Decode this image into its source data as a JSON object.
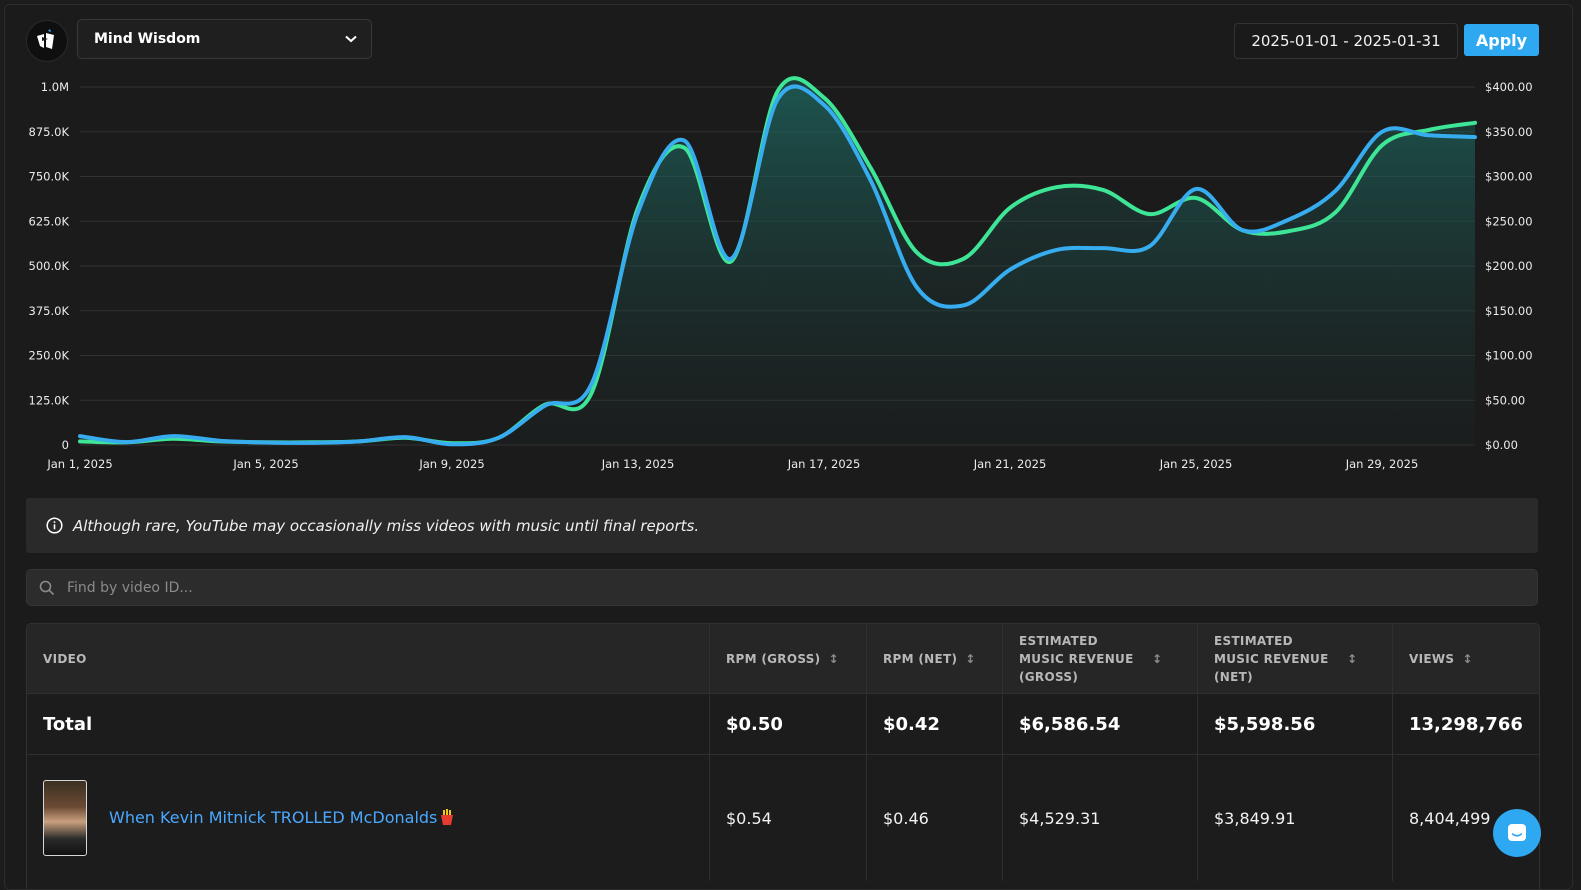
{
  "header": {
    "channel_name": "Mind Wisdom",
    "date_range": "2025-01-01 - 2025-01-31",
    "apply_label": "Apply"
  },
  "chart_data": {
    "type": "area",
    "x": [
      "Jan 1, 2025",
      "Jan 2, 2025",
      "Jan 3, 2025",
      "Jan 4, 2025",
      "Jan 5, 2025",
      "Jan 6, 2025",
      "Jan 7, 2025",
      "Jan 8, 2025",
      "Jan 9, 2025",
      "Jan 10, 2025",
      "Jan 11, 2025",
      "Jan 12, 2025",
      "Jan 13, 2025",
      "Jan 14, 2025",
      "Jan 15, 2025",
      "Jan 16, 2025",
      "Jan 17, 2025",
      "Jan 18, 2025",
      "Jan 19, 2025",
      "Jan 20, 2025",
      "Jan 21, 2025",
      "Jan 22, 2025",
      "Jan 23, 2025",
      "Jan 24, 2025",
      "Jan 25, 2025",
      "Jan 26, 2025",
      "Jan 27, 2025",
      "Jan 28, 2025",
      "Jan 29, 2025",
      "Jan 30, 2025",
      "Jan 31, 2025"
    ],
    "x_tick_labels": [
      "Jan 1, 2025",
      "Jan 5, 2025",
      "Jan 9, 2025",
      "Jan 13, 2025",
      "Jan 17, 2025",
      "Jan 21, 2025",
      "Jan 25, 2025",
      "Jan 29, 2025"
    ],
    "left_axis": {
      "ticks": [
        "0",
        "125.0K",
        "250.0K",
        "375.0K",
        "500.0K",
        "625.0K",
        "750.0K",
        "875.0K",
        "1.0M"
      ],
      "ylim": [
        0,
        1000000
      ]
    },
    "right_axis": {
      "ticks": [
        "$0.00",
        "$50.00",
        "$100.00",
        "$150.00",
        "$200.00",
        "$250.00",
        "$300.00",
        "$350.00",
        "$400.00"
      ],
      "ylim": [
        0,
        400
      ]
    },
    "series": [
      {
        "axis": "right",
        "color": "#3fe596",
        "values": [
          4,
          3,
          7,
          4,
          3,
          3,
          4,
          8,
          2,
          8,
          45,
          58,
          265,
          332,
          205,
          395,
          388,
          310,
          215,
          208,
          265,
          288,
          285,
          258,
          276,
          240,
          239,
          260,
          335,
          352,
          360
        ]
      },
      {
        "axis": "left",
        "color": "#37adf0",
        "values": [
          25000,
          8000,
          25000,
          12000,
          7000,
          6000,
          10000,
          22000,
          2000,
          20000,
          110000,
          170000,
          650000,
          850000,
          520000,
          965000,
          950000,
          740000,
          440000,
          390000,
          490000,
          545000,
          550000,
          555000,
          715000,
          600000,
          630000,
          710000,
          875000,
          865000,
          860000
        ]
      }
    ],
    "grid": true
  },
  "notice": {
    "text": "Although rare, YouTube may occasionally miss videos with music until final reports."
  },
  "search": {
    "placeholder": "Find by video ID..."
  },
  "table": {
    "columns": {
      "video": "VIDEO",
      "rpm_gross": "RPM (GROSS)",
      "rpm_net": "RPM (NET)",
      "est_gross": "ESTIMATED MUSIC REVENUE (GROSS)",
      "est_net": "ESTIMATED MUSIC REVENUE (NET)",
      "views": "VIEWS"
    },
    "total": {
      "label": "Total",
      "rpm_gross": "$0.50",
      "rpm_net": "$0.42",
      "est_gross": "$6,586.54",
      "est_net": "$5,598.56",
      "views": "13,298,766"
    },
    "rows": [
      {
        "title": "When Kevin Mitnick TROLLED McDonalds",
        "rpm_gross": "$0.54",
        "rpm_net": "$0.46",
        "est_gross": "$4,529.31",
        "est_net": "$3,849.91",
        "views": "8,404,499"
      }
    ]
  }
}
